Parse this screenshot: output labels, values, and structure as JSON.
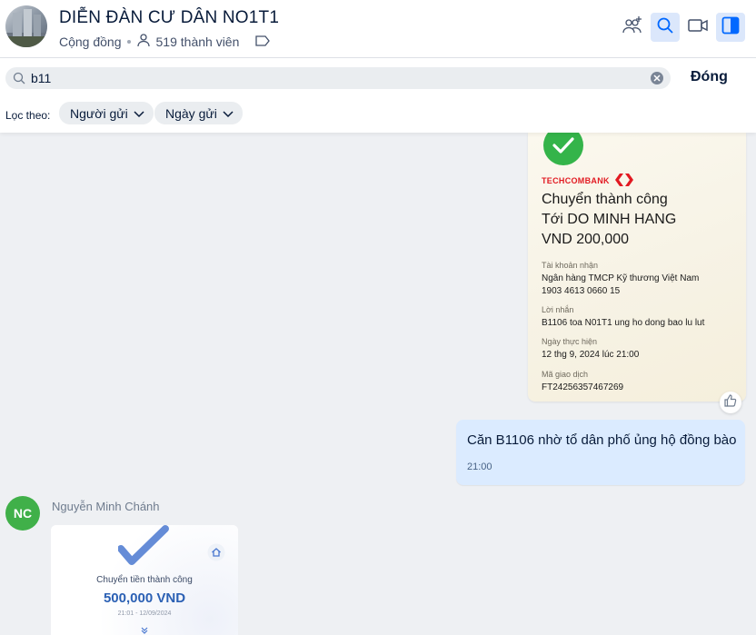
{
  "header": {
    "title": "DIỄN ĐÀN CƯ DÂN NO1T1",
    "type": "Cộng đồng",
    "members": "519 thành viên"
  },
  "search": {
    "value": "b11",
    "close_label": "Đóng",
    "filter_label": "Lọc theo:",
    "filters": [
      "Người gửi",
      "Ngày gửi"
    ]
  },
  "messages": {
    "bank_receipt": {
      "bank_name": "TECHCOMBANK",
      "status": "Chuyển thành công",
      "recipient": "Tới DO MINH HANG",
      "amount": "VND 200,000",
      "fields": [
        {
          "label": "Tài khoản nhận",
          "lines": [
            "Ngân hàng TMCP Kỹ thương Việt Nam",
            "1903 4613 0660 15"
          ]
        },
        {
          "label": "Lời nhắn",
          "lines": [
            "B1106 toa N01T1 ung ho dong bao lu lut"
          ]
        },
        {
          "label": "Ngày thực hiện",
          "lines": [
            "12 thg 9, 2024 lúc 21:00"
          ]
        },
        {
          "label": "Mã giao dịch",
          "lines": [
            "FT24256357467269"
          ]
        }
      ]
    },
    "own_message": {
      "text": "Căn B1106 nhờ tổ dân phố ủng hộ đồng bào",
      "time": "21:00"
    },
    "other_message": {
      "avatar_initials": "NC",
      "sender": "Nguyễn Minh Chánh",
      "receipt_title": "Chuyển tiền thành công",
      "receipt_amount": "500,000 VND",
      "receipt_date": "21:01 - 12/09/2024"
    }
  },
  "colors": {
    "accent": "#0068ff",
    "own_bubble": "#dbebff",
    "avatar_green": "#40b049",
    "success_green": "#34b44a",
    "bank_red": "#e21a22"
  }
}
